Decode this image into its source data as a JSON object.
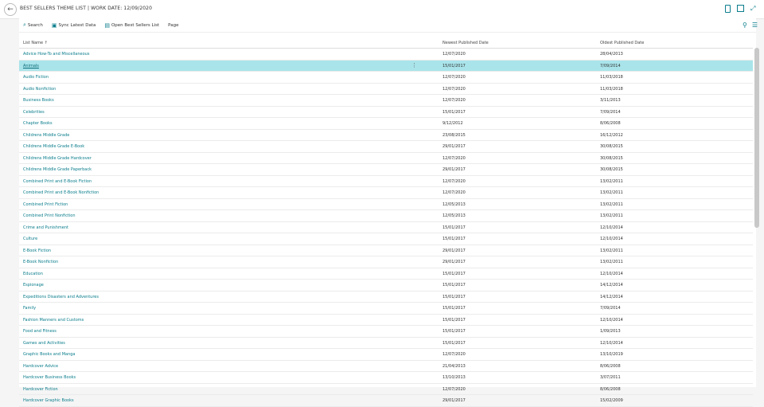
{
  "title": "BEST SELLERS THEME LIST | WORK DATE: 12/09/2020",
  "actions": {
    "search": "Search",
    "sync": "Sync Latest Data",
    "open": "Open Best Sellers List",
    "page": "Page"
  },
  "columns": {
    "list_name": "List Name ↑",
    "newest": "Newest Published Date",
    "oldest": "Oldest Published Date"
  },
  "rows": [
    {
      "name": "Advice How-To and Miscellaneous",
      "newest": "12/07/2020",
      "oldest": "28/04/2013"
    },
    {
      "name": "Animals",
      "newest": "15/01/2017",
      "oldest": "7/09/2014"
    },
    {
      "name": "Audio Fiction",
      "newest": "12/07/2020",
      "oldest": "11/03/2018"
    },
    {
      "name": "Audio Nonfiction",
      "newest": "12/07/2020",
      "oldest": "11/03/2018"
    },
    {
      "name": "Business Books",
      "newest": "12/07/2020",
      "oldest": "3/11/2013"
    },
    {
      "name": "Celebrities",
      "newest": "15/01/2017",
      "oldest": "7/09/2014"
    },
    {
      "name": "Chapter Books",
      "newest": "9/12/2012",
      "oldest": "8/06/2008"
    },
    {
      "name": "Childrens Middle Grade",
      "newest": "23/08/2015",
      "oldest": "16/12/2012"
    },
    {
      "name": "Childrens Middle Grade E-Book",
      "newest": "29/01/2017",
      "oldest": "30/08/2015"
    },
    {
      "name": "Childrens Middle Grade Hardcover",
      "newest": "12/07/2020",
      "oldest": "30/08/2015"
    },
    {
      "name": "Childrens Middle Grade Paperback",
      "newest": "29/01/2017",
      "oldest": "30/08/2015"
    },
    {
      "name": "Combined Print and E-Book Fiction",
      "newest": "12/07/2020",
      "oldest": "13/02/2011"
    },
    {
      "name": "Combined Print and E-Book Nonfiction",
      "newest": "12/07/2020",
      "oldest": "13/02/2011"
    },
    {
      "name": "Combined Print Fiction",
      "newest": "12/05/2013",
      "oldest": "13/02/2011"
    },
    {
      "name": "Combined Print Nonfiction",
      "newest": "12/05/2013",
      "oldest": "13/02/2011"
    },
    {
      "name": "Crime and Punishment",
      "newest": "15/01/2017",
      "oldest": "12/10/2014"
    },
    {
      "name": "Culture",
      "newest": "15/01/2017",
      "oldest": "12/10/2014"
    },
    {
      "name": "E-Book Fiction",
      "newest": "29/01/2017",
      "oldest": "13/02/2011"
    },
    {
      "name": "E-Book Nonfiction",
      "newest": "29/01/2017",
      "oldest": "13/02/2011"
    },
    {
      "name": "Education",
      "newest": "15/01/2017",
      "oldest": "12/10/2014"
    },
    {
      "name": "Espionage",
      "newest": "15/01/2017",
      "oldest": "14/12/2014"
    },
    {
      "name": "Expeditions Disasters and Adventures",
      "newest": "15/01/2017",
      "oldest": "14/12/2014"
    },
    {
      "name": "Family",
      "newest": "15/01/2017",
      "oldest": "7/09/2014"
    },
    {
      "name": "Fashion Manners and Customs",
      "newest": "15/01/2017",
      "oldest": "12/10/2014"
    },
    {
      "name": "Food and Fitness",
      "newest": "15/01/2017",
      "oldest": "1/09/2013"
    },
    {
      "name": "Games and Activities",
      "newest": "15/01/2017",
      "oldest": "12/10/2014"
    },
    {
      "name": "Graphic Books and Manga",
      "newest": "12/07/2020",
      "oldest": "13/10/2019"
    },
    {
      "name": "Hardcover Advice",
      "newest": "21/04/2013",
      "oldest": "8/06/2008"
    },
    {
      "name": "Hardcover Business Books",
      "newest": "13/10/2013",
      "oldest": "3/07/2011"
    },
    {
      "name": "Hardcover Fiction",
      "newest": "12/07/2020",
      "oldest": "8/06/2008"
    },
    {
      "name": "Hardcover Graphic Books",
      "newest": "29/01/2017",
      "oldest": "15/02/2009"
    }
  ],
  "selected_row": 1,
  "accent": "#0a7d8c",
  "selected_bg": "#a9e4ea"
}
